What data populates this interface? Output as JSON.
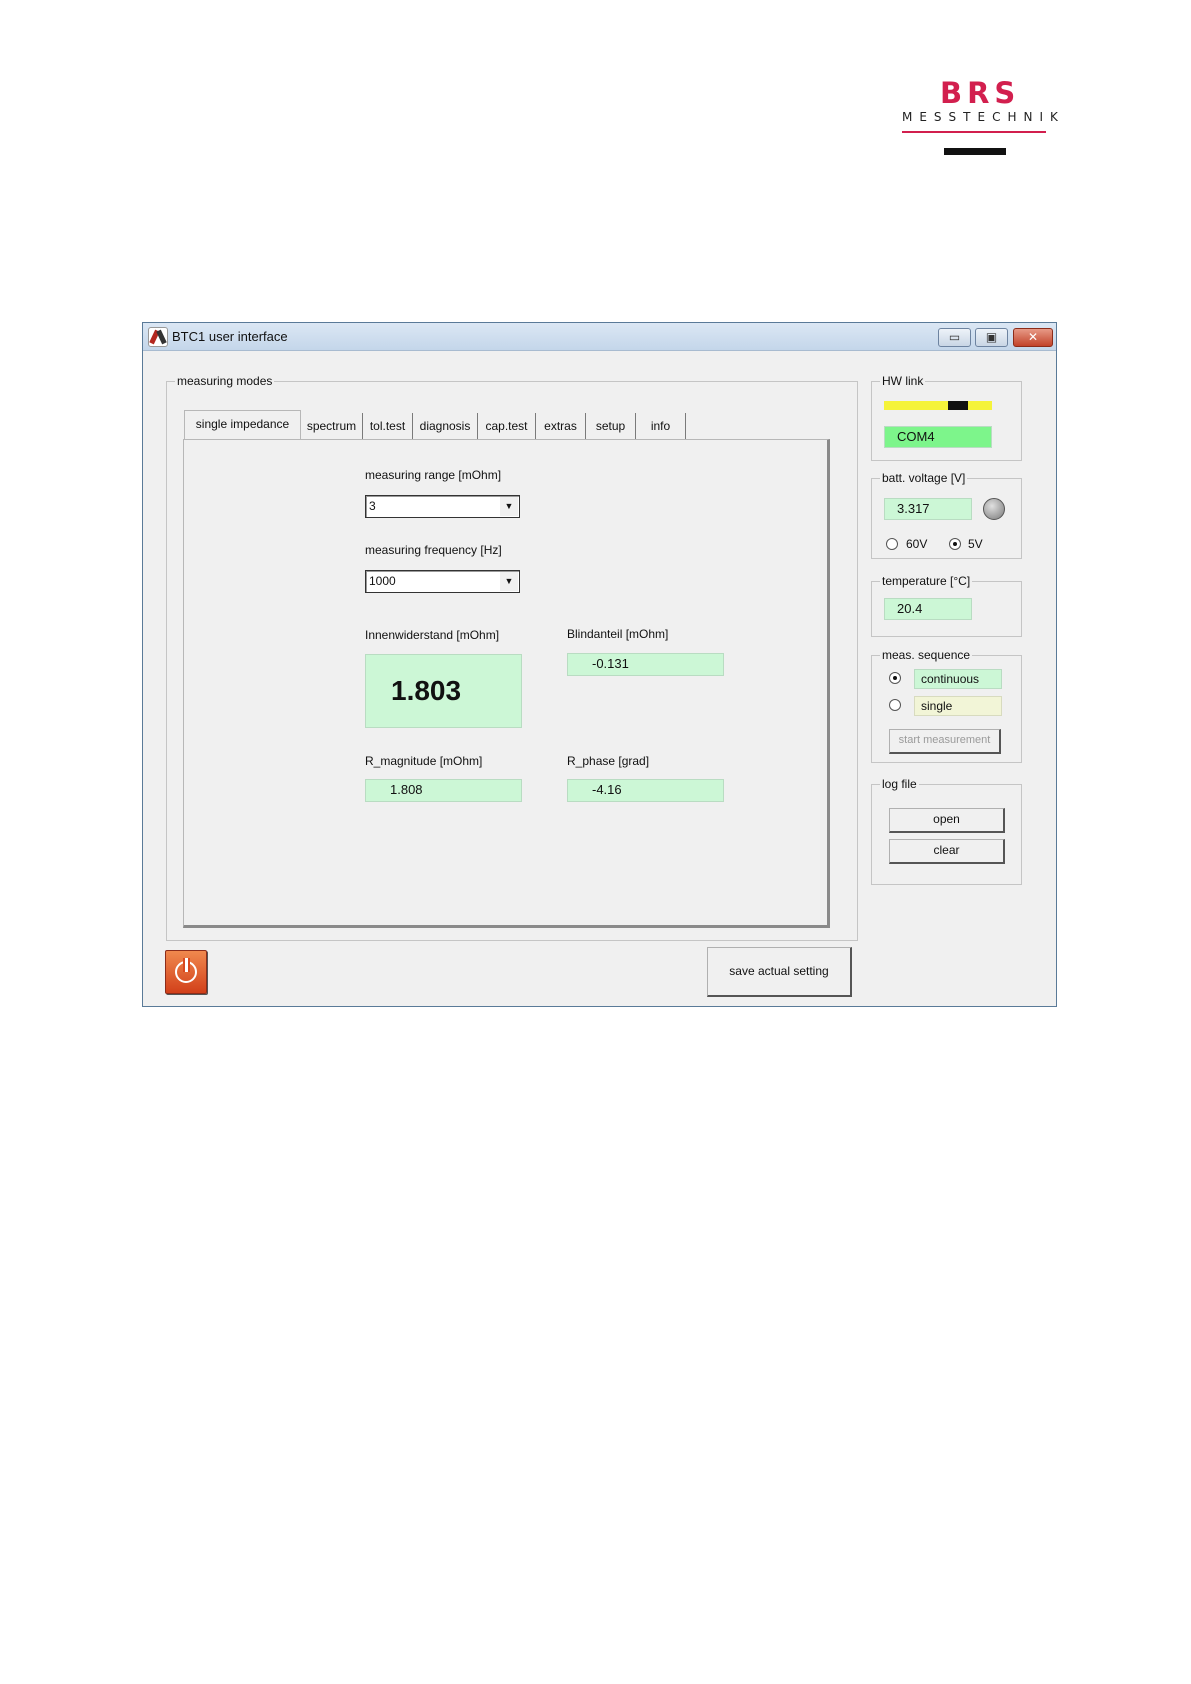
{
  "logo": {
    "brand": "BRS",
    "subtitle": "MESSTECHNIK"
  },
  "window": {
    "title": "BTC1 user interface",
    "controls": {
      "minimize": "▭",
      "maximize": "▣",
      "close": "✕"
    }
  },
  "measuring_modes": {
    "title": "measuring modes",
    "tabs": [
      {
        "label": "single impedance",
        "active": true
      },
      {
        "label": "spectrum"
      },
      {
        "label": "tol.test"
      },
      {
        "label": "diagnosis"
      },
      {
        "label": "cap.test"
      },
      {
        "label": "extras"
      },
      {
        "label": "setup"
      },
      {
        "label": "info"
      }
    ],
    "single_impedance": {
      "range_label": "measuring range [mOhm]",
      "range_value": "3",
      "frequency_label": "measuring frequency [Hz]",
      "frequency_value": "1000",
      "innenwiderstand_label": "Innenwiderstand [mOhm]",
      "innenwiderstand_value": "1.803",
      "blindanteil_label": "Blindanteil [mOhm]",
      "blindanteil_value": "-0.131",
      "r_magnitude_label": "R_magnitude [mOhm]",
      "r_magnitude_value": "1.808",
      "r_phase_label": "R_phase [grad]",
      "r_phase_value": "-4.16"
    }
  },
  "hw_link": {
    "title": "HW link",
    "port": "COM4"
  },
  "batt_voltage": {
    "title": "batt. voltage [V]",
    "value": "3.317",
    "option_60v": "60V",
    "option_5v": "5V",
    "selected": "5V"
  },
  "temperature": {
    "title": "temperature [°C]",
    "value": "20.4"
  },
  "meas_sequence": {
    "title": "meas. sequence",
    "continuous": "continuous",
    "single": "single",
    "selected": "continuous",
    "start_button": "start measurement"
  },
  "log_file": {
    "title": "log file",
    "open_button": "open",
    "clear_button": "clear"
  },
  "footer": {
    "save_button": "save actual setting"
  },
  "colors": {
    "brand": "#d21f4e",
    "value_bg": "#ccf7d6",
    "com_bg": "#7df58b",
    "hw_bar": "#f5f33a",
    "power_btn": "#d2401a"
  }
}
